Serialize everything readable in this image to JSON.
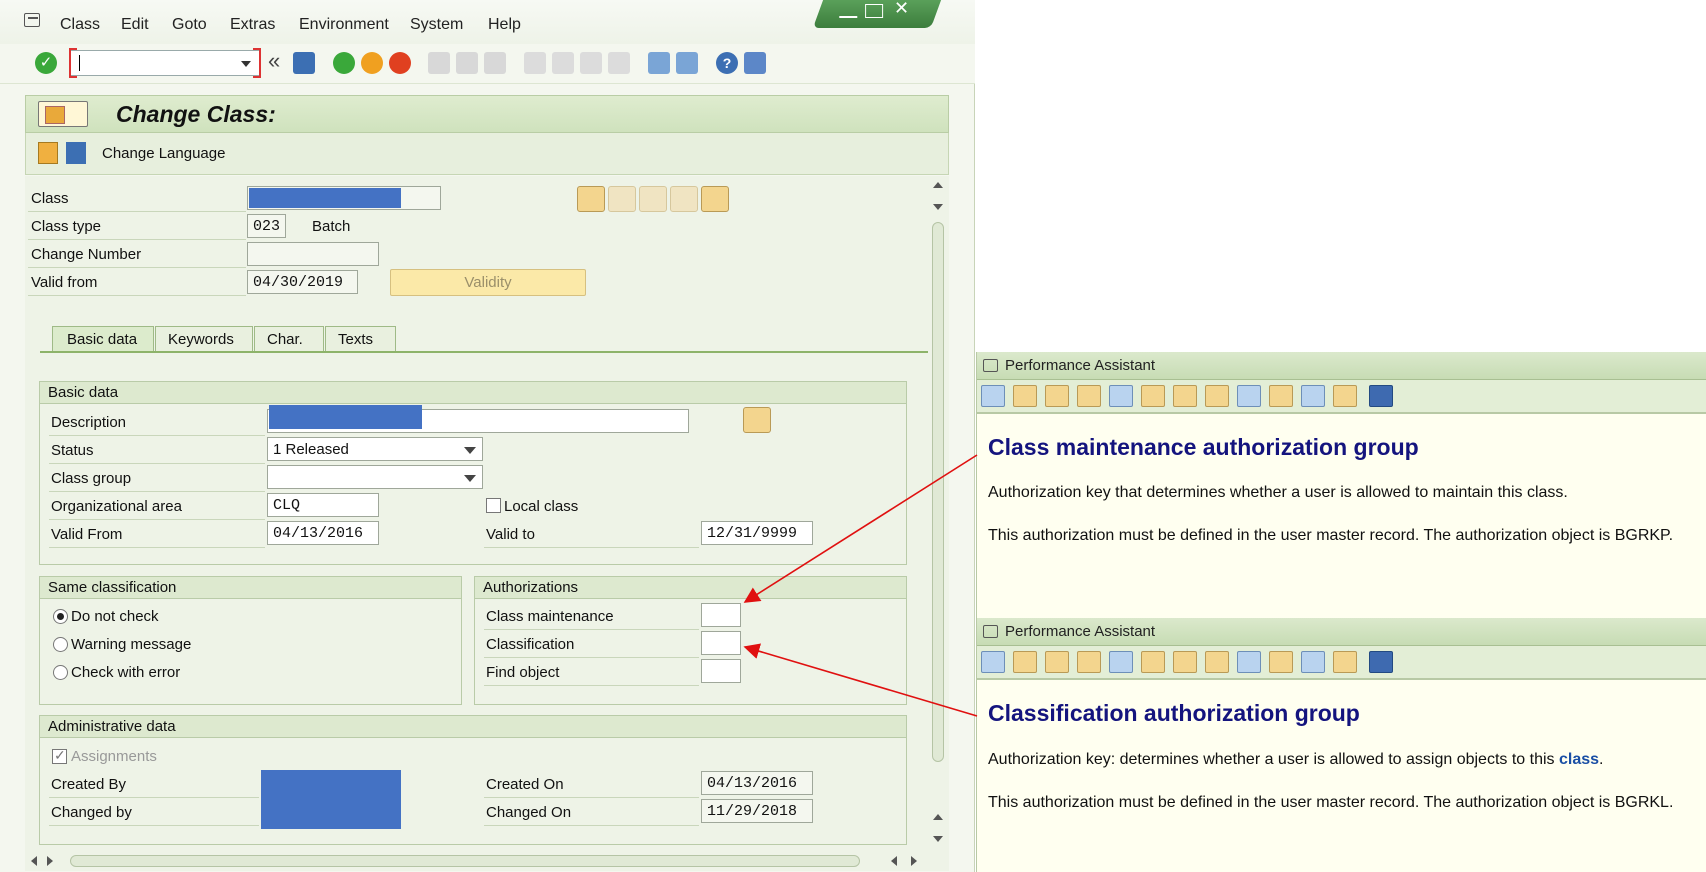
{
  "menu": {
    "items": [
      "Class",
      "Edit",
      "Goto",
      "Extras",
      "Environment",
      "System",
      "Help"
    ]
  },
  "toolbar": {
    "command_value": "",
    "nav_back_label": "«"
  },
  "title": {
    "text": "Change Class:"
  },
  "appbar": {
    "change_language_label": "Change Language"
  },
  "header": {
    "class_label": "Class",
    "class_type_label": "Class type",
    "class_type_value": "023",
    "class_type_name": "Batch",
    "change_number_label": "Change Number",
    "change_number_value": "",
    "valid_from_label": "Valid from",
    "valid_from_value": "04/30/2019",
    "validity_button": "Validity"
  },
  "tabs": [
    {
      "label": "Basic data",
      "active": true
    },
    {
      "label": "Keywords",
      "active": false
    },
    {
      "label": "Char.",
      "active": false
    },
    {
      "label": "Texts",
      "active": false
    }
  ],
  "basic_data": {
    "group_title": "Basic data",
    "description_label": "Description",
    "status_label": "Status",
    "status_value": "1 Released",
    "class_group_label": "Class group",
    "class_group_value": "",
    "org_area_label": "Organizational area",
    "org_area_value": "CLQ",
    "local_class_label": "Local class",
    "local_class_checked": false,
    "valid_from_label": "Valid From",
    "valid_from_value": "04/13/2016",
    "valid_to_label": "Valid to",
    "valid_to_value": "12/31/9999"
  },
  "same_classification": {
    "group_title": "Same classification",
    "options": [
      "Do not check",
      "Warning message",
      "Check with error"
    ],
    "selected": "Do not check"
  },
  "authorizations": {
    "group_title": "Authorizations",
    "class_maintenance_label": "Class maintenance",
    "class_maintenance_value": "",
    "classification_label": "Classification",
    "classification_value": "",
    "find_object_label": "Find object",
    "find_object_value": ""
  },
  "admin": {
    "group_title": "Administrative data",
    "assignments_label": "Assignments",
    "assignments_checked": true,
    "created_by_label": "Created By",
    "changed_by_label": "Changed by",
    "created_on_label": "Created On",
    "created_on_value": "04/13/2016",
    "changed_on_label": "Changed On",
    "changed_on_value": "11/29/2018"
  },
  "assistant_1": {
    "header": "Performance Assistant",
    "title": "Class maintenance authorization group",
    "para1": "Authorization key that determines whether a user is allowed to maintain this class.",
    "para2": "This authorization must be defined in the user master record. The authorization object is BGRKP."
  },
  "assistant_2": {
    "header": "Performance Assistant",
    "title": "Classification authorization group",
    "para1_prefix": "Authorization key: determines whether a user is allowed to assign objects to this ",
    "para1_link": "class",
    "para1_suffix": ".",
    "para2": "This authorization must be defined in the user master record. The authorization object is BGRKL."
  },
  "colors": {
    "accent_green": "#3c7d3c",
    "redaction_blue": "#4472c4",
    "help_title": "#14147e",
    "annotation_arrow": "#e01010"
  }
}
